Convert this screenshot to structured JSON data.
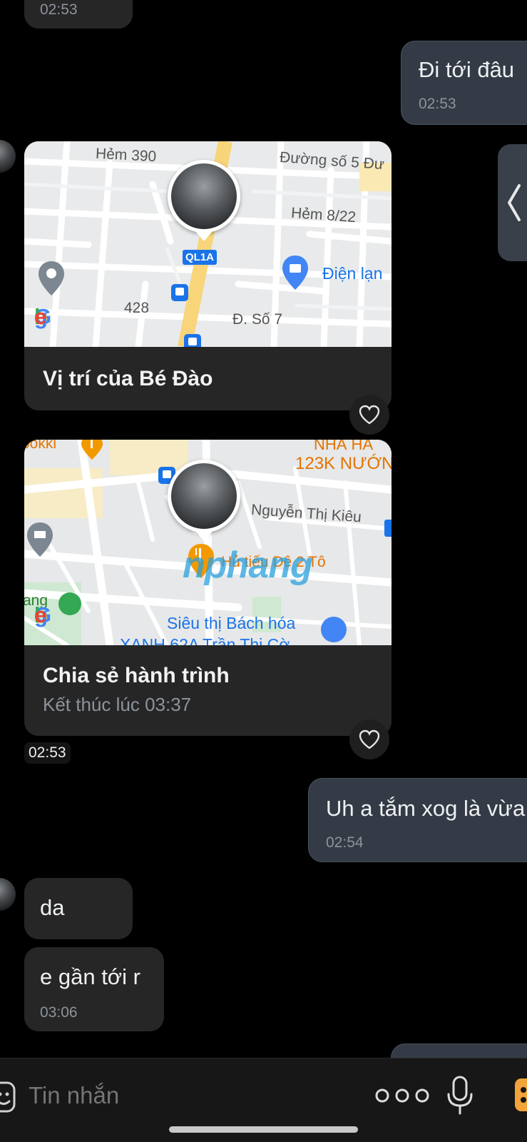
{
  "messages": {
    "top_in_time": "02:53",
    "out1_text": "Đi tới đâu",
    "out1_time": "02:53",
    "location_card": {
      "title": "Vị trí của Bé Đào",
      "map_labels": {
        "hem390": "Hẻm 390",
        "duongso5": "Đường số 5 Đư",
        "hem822": "Hẻm 8/22",
        "ql1a": "QL1A",
        "dienlanh": "Điện lạn",
        "num428": "428",
        "dso7": "Đ. Số 7",
        "google": "Google"
      }
    },
    "trip_card": {
      "title": "Chia sẻ hành trình",
      "subtitle": "Kết thúc lúc 03:37",
      "map_labels": {
        "ookki": "ookki",
        "nhahang": "NHÀ HÀ",
        "nuong": "123K NƯỚN",
        "nguyenthikieu": "Nguyễn Thị Kiêu",
        "hutieu": "Hủ tiếu Dê 2 Tô",
        "sieuthi": "Siêu thị Bách hóa",
        "xanh": "XANH 62A Trần Thị Cờ",
        "cong": "ang",
        "google": "Google",
        "watermark": "nphang"
      }
    },
    "trip_time": "02:53",
    "out2_text": "Uh a tắm xog là vừa",
    "out2_time": "02:54",
    "in2_text": "da",
    "in3_text": "e gần tới r",
    "in3_time": "03:06"
  },
  "input": {
    "placeholder": "Tin nhắn"
  },
  "icons": {
    "heart": "heart-icon",
    "emoji": "sticker-icon",
    "more": "more-icon",
    "mic": "mic-icon",
    "gallery": "gallery-icon",
    "back": "chevron-left-icon"
  },
  "colors": {
    "background": "#000000",
    "bubble_in": "#262626",
    "bubble_out": "#343b46",
    "map_road_major": "#f8d57a",
    "accent_blue": "#1a73e8"
  }
}
